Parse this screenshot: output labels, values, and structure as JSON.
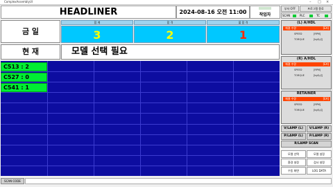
{
  "window": {
    "title": "ComplexAssemblyUI"
  },
  "header": {
    "title": "HEADLINER",
    "datetime": "2024-08-16 오전 11:00",
    "worker_label": "작업자"
  },
  "toolbar": {
    "buzzer_off": "부저 OFF",
    "program_exit": "프로그램 종료",
    "scan": "SCAN",
    "plc": "PLC",
    "tc": "TC"
  },
  "summary": {
    "today_label": "금 일",
    "current_label": "현 재",
    "heads": [
      "합 계",
      "합 격",
      "불 합 격"
    ],
    "values": [
      "3",
      "2",
      "1"
    ],
    "value_colors": [
      "#ffff00",
      "#ffff00",
      "#ff2a00"
    ],
    "model_text": "모델 선택 필요"
  },
  "status_rows": [
    "C513 : 2",
    "C527 : 0",
    "C541 : 1"
  ],
  "panels": [
    {
      "title": "(L) A/HDL",
      "sub": "체결 수량",
      "unit": "[EA]",
      "speed": "SPEED",
      "speed_u": "[RPM]",
      "torque": "TORQUE",
      "torque_u": "[kgf/㎠]"
    },
    {
      "title": "(R) A/HDL",
      "sub": "체결 수량",
      "unit": "[EA]",
      "speed": "SPEED",
      "speed_u": "[RPM]",
      "torque": "TORQUE",
      "torque_u": "[kgf/㎠]"
    },
    {
      "title": "RETAINER",
      "sub": "체결 수량",
      "unit": "[EA]",
      "speed": "SPEED",
      "speed_u": "[RPM]",
      "torque": "TORQUE",
      "torque_u": "[kgf/㎠]"
    }
  ],
  "lamps": [
    "V/LAMP (L)",
    "V/LAMP (R)",
    "P/LAMP (L)",
    "P/LAMP (R)",
    "R/LAMP SCAN"
  ],
  "menu": [
    "모델 선택",
    "모델 설정",
    "환경 설정",
    "검사 설정",
    "수동 화면",
    "LOG DATA"
  ],
  "footer": {
    "scan_code": "SCAN CODE"
  },
  "colors": {
    "grid": "#0d0da0",
    "ok": "#00ee33",
    "accent": "#00c8ff",
    "alarm": "#ff4400"
  }
}
